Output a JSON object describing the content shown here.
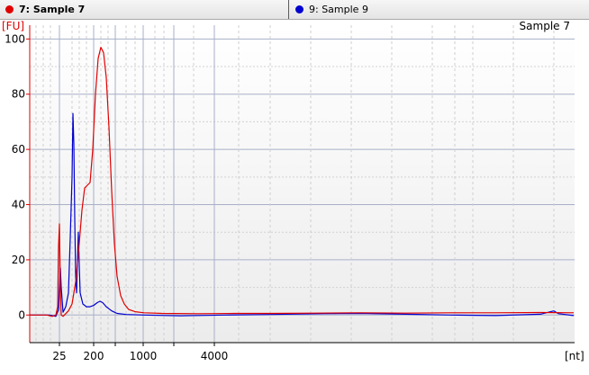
{
  "tabs": [
    {
      "label": "7: Sample 7",
      "dot_color": "#e00000",
      "active": true
    },
    {
      "label": "9: Sample 9",
      "dot_color": "#0000d0",
      "active": false
    }
  ],
  "chart_data": {
    "type": "line",
    "title": "Sample 7",
    "ylabel": "[FU]",
    "xlabel": "[nt]",
    "ylim": [
      -10,
      105
    ],
    "y_ticks": [
      0,
      20,
      40,
      60,
      80,
      100
    ],
    "x_tick_labels": [
      "25",
      "200",
      "1000",
      "4000"
    ],
    "x_scale": "ladder (migration time)",
    "grid": true,
    "series": [
      {
        "sample": "7",
        "color": "#e00000",
        "points": [
          [
            33,
            0
          ],
          [
            52,
            0
          ],
          [
            58,
            -0.5
          ],
          [
            62,
            0
          ],
          [
            64,
            3
          ],
          [
            65,
            25
          ],
          [
            66,
            33
          ],
          [
            67,
            10
          ],
          [
            68,
            0
          ],
          [
            70,
            -0.5
          ],
          [
            73,
            0.5
          ],
          [
            76,
            1.5
          ],
          [
            80,
            4
          ],
          [
            84,
            12
          ],
          [
            88,
            26
          ],
          [
            91,
            38
          ],
          [
            94,
            46
          ],
          [
            97,
            47
          ],
          [
            100,
            48
          ],
          [
            103,
            60
          ],
          [
            106,
            80
          ],
          [
            109,
            93
          ],
          [
            112,
            97
          ],
          [
            115,
            95
          ],
          [
            118,
            86
          ],
          [
            121,
            68
          ],
          [
            124,
            45
          ],
          [
            127,
            26
          ],
          [
            130,
            14
          ],
          [
            134,
            7
          ],
          [
            138,
            4
          ],
          [
            143,
            2
          ],
          [
            150,
            1.2
          ],
          [
            160,
            0.8
          ],
          [
            180,
            0.6
          ],
          [
            220,
            0.5
          ],
          [
            260,
            0.6
          ],
          [
            300,
            0.6
          ],
          [
            350,
            0.7
          ],
          [
            400,
            0.8
          ],
          [
            450,
            0.7
          ],
          [
            500,
            0.8
          ],
          [
            550,
            0.8
          ],
          [
            600,
            0.9
          ],
          [
            637,
            0.8
          ]
        ]
      },
      {
        "sample": "9",
        "color": "#0000d0",
        "points": [
          [
            33,
            0
          ],
          [
            55,
            0
          ],
          [
            62,
            -0.5
          ],
          [
            65,
            2
          ],
          [
            67,
            17
          ],
          [
            68,
            10
          ],
          [
            70,
            1
          ],
          [
            73,
            3
          ],
          [
            76,
            8
          ],
          [
            78,
            28
          ],
          [
            80,
            50
          ],
          [
            81,
            73
          ],
          [
            82,
            62
          ],
          [
            83,
            35
          ],
          [
            84,
            14
          ],
          [
            85,
            8
          ],
          [
            86,
            20
          ],
          [
            87,
            30
          ],
          [
            88,
            18
          ],
          [
            89,
            8
          ],
          [
            92,
            4
          ],
          [
            96,
            3
          ],
          [
            100,
            3
          ],
          [
            104,
            3.5
          ],
          [
            108,
            4.5
          ],
          [
            111,
            5
          ],
          [
            114,
            4.5
          ],
          [
            118,
            3
          ],
          [
            124,
            1.5
          ],
          [
            130,
            0.6
          ],
          [
            140,
            0.2
          ],
          [
            160,
            0
          ],
          [
            200,
            -0.3
          ],
          [
            250,
            0
          ],
          [
            300,
            0.2
          ],
          [
            360,
            0.5
          ],
          [
            400,
            0.6
          ],
          [
            450,
            0.3
          ],
          [
            500,
            0
          ],
          [
            550,
            -0.2
          ],
          [
            600,
            0.3
          ],
          [
            615,
            1.5
          ],
          [
            620,
            0.5
          ],
          [
            637,
            -0.2
          ]
        ]
      }
    ]
  }
}
